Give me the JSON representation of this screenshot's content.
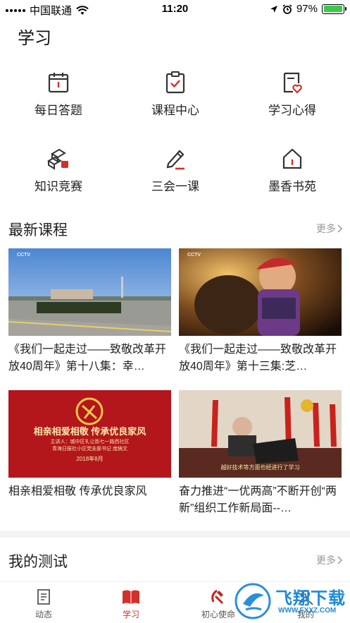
{
  "status_bar": {
    "carrier": "中国联通",
    "time": "11:20",
    "battery": "97%",
    "battery_level": 0.97
  },
  "page": {
    "title": "学习"
  },
  "grid": [
    {
      "label": "每日答题",
      "icon": "calendar-icon"
    },
    {
      "label": "课程中心",
      "icon": "clipboard-check-icon"
    },
    {
      "label": "学习心得",
      "icon": "notebook-heart-icon"
    },
    {
      "label": "知识竞赛",
      "icon": "blocks-icon"
    },
    {
      "label": "三会一课",
      "icon": "pencil-icon"
    },
    {
      "label": "墨香书苑",
      "icon": "house-icon"
    }
  ],
  "latest_courses": {
    "title": "最新课程",
    "more": "更多",
    "items": [
      {
        "title": "《我们一起走过——致敬改革开放40周年》第十八集：幸…",
        "badge": "CCTV"
      },
      {
        "title": "《我们一起走过——致敬改革开放40周年》第十三集:芝…",
        "badge": "CCTV"
      },
      {
        "title": "相亲相爱相敬 传承优良家风",
        "banner_head": "相亲相爱相敬 传承优良家风",
        "banner_sub1": "主讲人：城中区礼让街七一路西社区",
        "banner_sub2": "青海日报社小区党支部书记  庞納文",
        "banner_date": "2018年8月"
      },
      {
        "title": "奋力推进“一优两高”不断开创“两新”组织工作新局面--…",
        "caption": "越好技术等方面也经进行了学习"
      }
    ]
  },
  "my_tests": {
    "title": "我的测试",
    "more": "更多"
  },
  "tabbar": {
    "tabs": [
      {
        "label": "动态",
        "icon": "document-icon"
      },
      {
        "label": "学习",
        "icon": "book-icon"
      },
      {
        "label": "初心使命",
        "icon": "party-emblem-icon"
      },
      {
        "label": "我的",
        "icon": "person-icon"
      }
    ]
  },
  "watermark": {
    "text": "飞翔下载",
    "url": "WWW.FXXZ.COM"
  },
  "colors": {
    "accent": "#d3302a",
    "text": "#222222",
    "muted": "#999999"
  }
}
